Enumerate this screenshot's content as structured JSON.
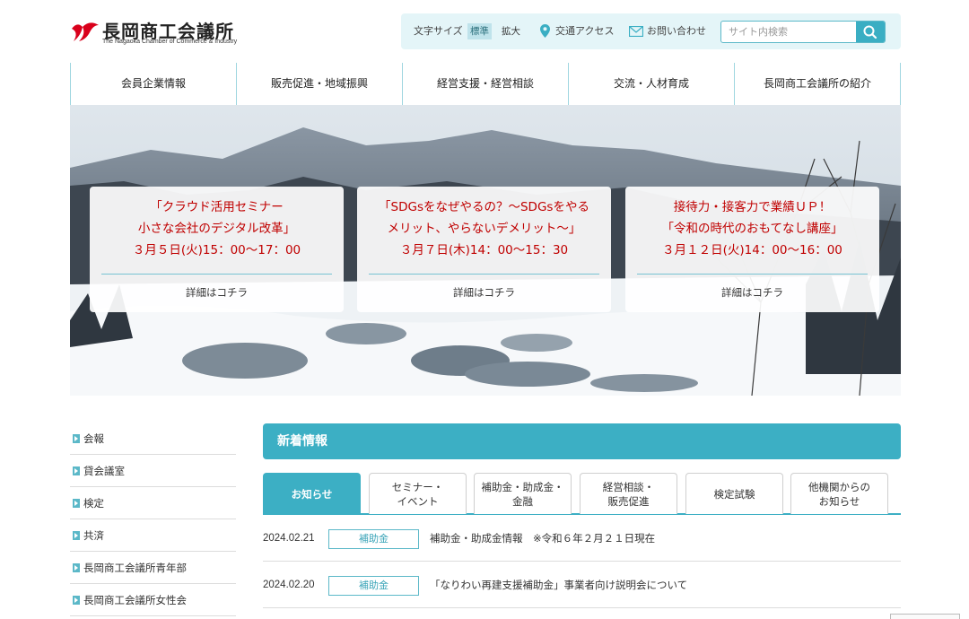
{
  "header": {
    "logo_title": "長岡商工会議所",
    "logo_subtitle": "The Nagaoka Chamber of Commerce & Industry"
  },
  "utility": {
    "font_size_label": "文字サイズ",
    "size_standard": "標準",
    "size_large": "拡大",
    "access_label": "交通アクセス",
    "contact_label": "お問い合わせ",
    "search_placeholder": "サイト内検索"
  },
  "nav": {
    "items": [
      {
        "label": "会員企業情報"
      },
      {
        "label": "販売促進・地域振興"
      },
      {
        "label": "経営支援・経営相談"
      },
      {
        "label": "交流・人材育成"
      },
      {
        "label": "長岡商工会議所の紹介"
      }
    ]
  },
  "hero": {
    "cards": [
      {
        "line1": "「クラウド活用セミナー",
        "line2": "小さな会社のデジタル改革」",
        "line3": "３月５日(火)15：00〜17：00",
        "more": "詳細はコチラ"
      },
      {
        "line1": "「SDGsをなぜやるの？〜SDGsをやる",
        "line2": "メリット、やらないデメリット〜」",
        "line3": "３月７日(木)14：00〜15：30",
        "more": "詳細はコチラ"
      },
      {
        "line1": "接待力・接客力で業績ＵＰ！",
        "line2": "「令和の時代のおもてなし講座」",
        "line3": "３月１２日(火)14：00〜16：00",
        "more": "詳細はコチラ"
      }
    ]
  },
  "sidebar": {
    "items": [
      {
        "label": "会報"
      },
      {
        "label": "貸会議室"
      },
      {
        "label": "検定"
      },
      {
        "label": "共済"
      },
      {
        "label": "長岡商工会議所青年部"
      },
      {
        "label": "長岡商工会議所女性会"
      }
    ]
  },
  "news": {
    "heading": "新着情報",
    "tabs": [
      {
        "line1": "お知らせ",
        "line2": ""
      },
      {
        "line1": "セミナー・",
        "line2": "イベント"
      },
      {
        "line1": "補助金・助成金・",
        "line2": "金融"
      },
      {
        "line1": "経営相談・",
        "line2": "販売促進"
      },
      {
        "line1": "検定試験",
        "line2": ""
      },
      {
        "line1": "他機関からの",
        "line2": "お知らせ"
      }
    ],
    "items": [
      {
        "date": "2024.02.21",
        "category": "補助金",
        "title": "補助金・助成金情報　※令和６年２月２１日現在"
      },
      {
        "date": "2024.02.20",
        "category": "補助金",
        "title": "「なりわい再建支援補助金」事業者向け説明会について"
      }
    ]
  },
  "colors": {
    "accent": "#3cafc4",
    "brand_red": "#d9001b",
    "event_text": "#c00000"
  }
}
